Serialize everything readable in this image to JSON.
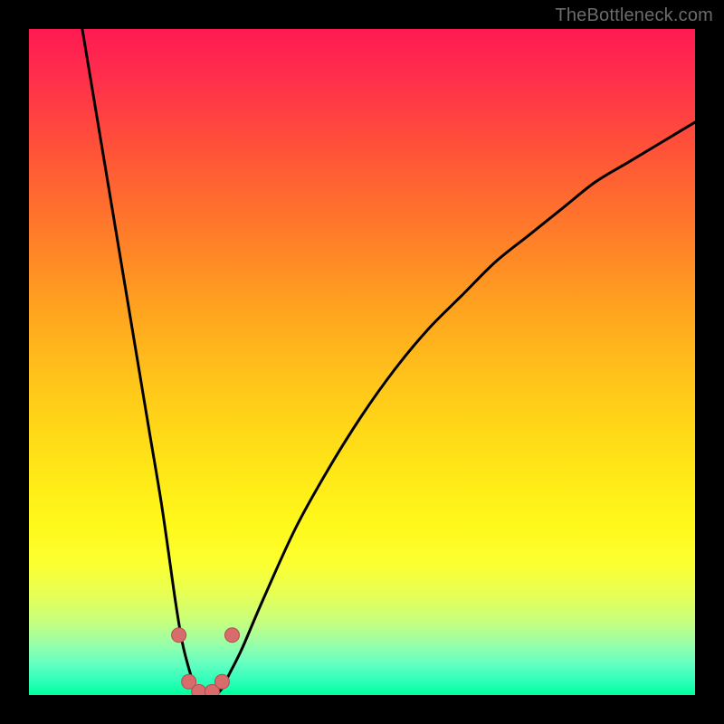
{
  "watermark": {
    "text": "TheBottleneck.com"
  },
  "colors": {
    "frame": "#000000",
    "curve": "#000000",
    "marker_fill": "#d86b6b",
    "marker_stroke": "#b24e4e",
    "gradient_stops": [
      "#ff1a52",
      "#ff2e4c",
      "#ff5238",
      "#ff7a2a",
      "#ffa31f",
      "#ffc819",
      "#ffe617",
      "#fff81a",
      "#fcff2f",
      "#e6ff55",
      "#c6ff7e",
      "#9dffa4",
      "#6affc1",
      "#2bffb9",
      "#00ff9c"
    ]
  },
  "chart_data": {
    "type": "line",
    "title": "",
    "xlabel": "",
    "ylabel": "",
    "xlim": [
      0,
      100
    ],
    "ylim": [
      0,
      100
    ],
    "grid": false,
    "note": "V-shaped bottleneck curve. y≈0 (green → no bottleneck) around x≈24–30; y→100 (red → severe bottleneck) toward x→0 and x→100. Values are read off the normalized plot area; axes carry no tick labels in the source image.",
    "series": [
      {
        "name": "left-branch",
        "x": [
          8,
          10,
          12,
          14,
          16,
          18,
          20,
          22,
          23,
          24,
          25,
          26
        ],
        "y": [
          100,
          88,
          76,
          64,
          52,
          40,
          28,
          14,
          8,
          4,
          1,
          0
        ]
      },
      {
        "name": "right-branch",
        "x": [
          28,
          29,
          30,
          32,
          35,
          40,
          45,
          50,
          55,
          60,
          65,
          70,
          75,
          80,
          85,
          90,
          95,
          100
        ],
        "y": [
          0,
          1,
          3,
          7,
          14,
          25,
          34,
          42,
          49,
          55,
          60,
          65,
          69,
          73,
          77,
          80,
          83,
          86
        ]
      }
    ],
    "markers": [
      {
        "x": 22.5,
        "y": 9
      },
      {
        "x": 24.0,
        "y": 2
      },
      {
        "x": 25.5,
        "y": 0.5
      },
      {
        "x": 27.5,
        "y": 0.5
      },
      {
        "x": 29.0,
        "y": 2
      },
      {
        "x": 30.5,
        "y": 9
      }
    ]
  }
}
